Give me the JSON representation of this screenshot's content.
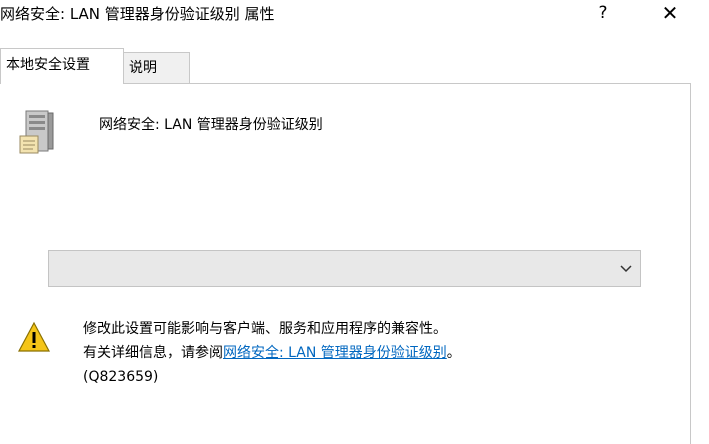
{
  "window": {
    "title": "网络安全: LAN 管理器身份验证级别 属性",
    "help_label": "?",
    "close_label": "✕"
  },
  "tabs": [
    {
      "label": "本地安全设置",
      "active": true
    },
    {
      "label": "说明",
      "active": false
    }
  ],
  "policy": {
    "name": "网络安全: LAN 管理器身份验证级别",
    "icon": "server-icon"
  },
  "dropdown": {
    "selected": "",
    "icon": "chevron-down-icon"
  },
  "warning": {
    "icon": "warning-icon",
    "line1": "修改此设置可能影响与客户端、服务和应用程序的兼容性。",
    "line2_prefix": "有关详细信息，请参阅",
    "link_text": "网络安全: LAN 管理器身份验证级别",
    "line2_suffix": "。",
    "line3": "(Q823659)"
  },
  "colors": {
    "link": "#0067c0",
    "dropdown_bg": "#e8e8e8",
    "warning_fill": "#f5c518"
  }
}
